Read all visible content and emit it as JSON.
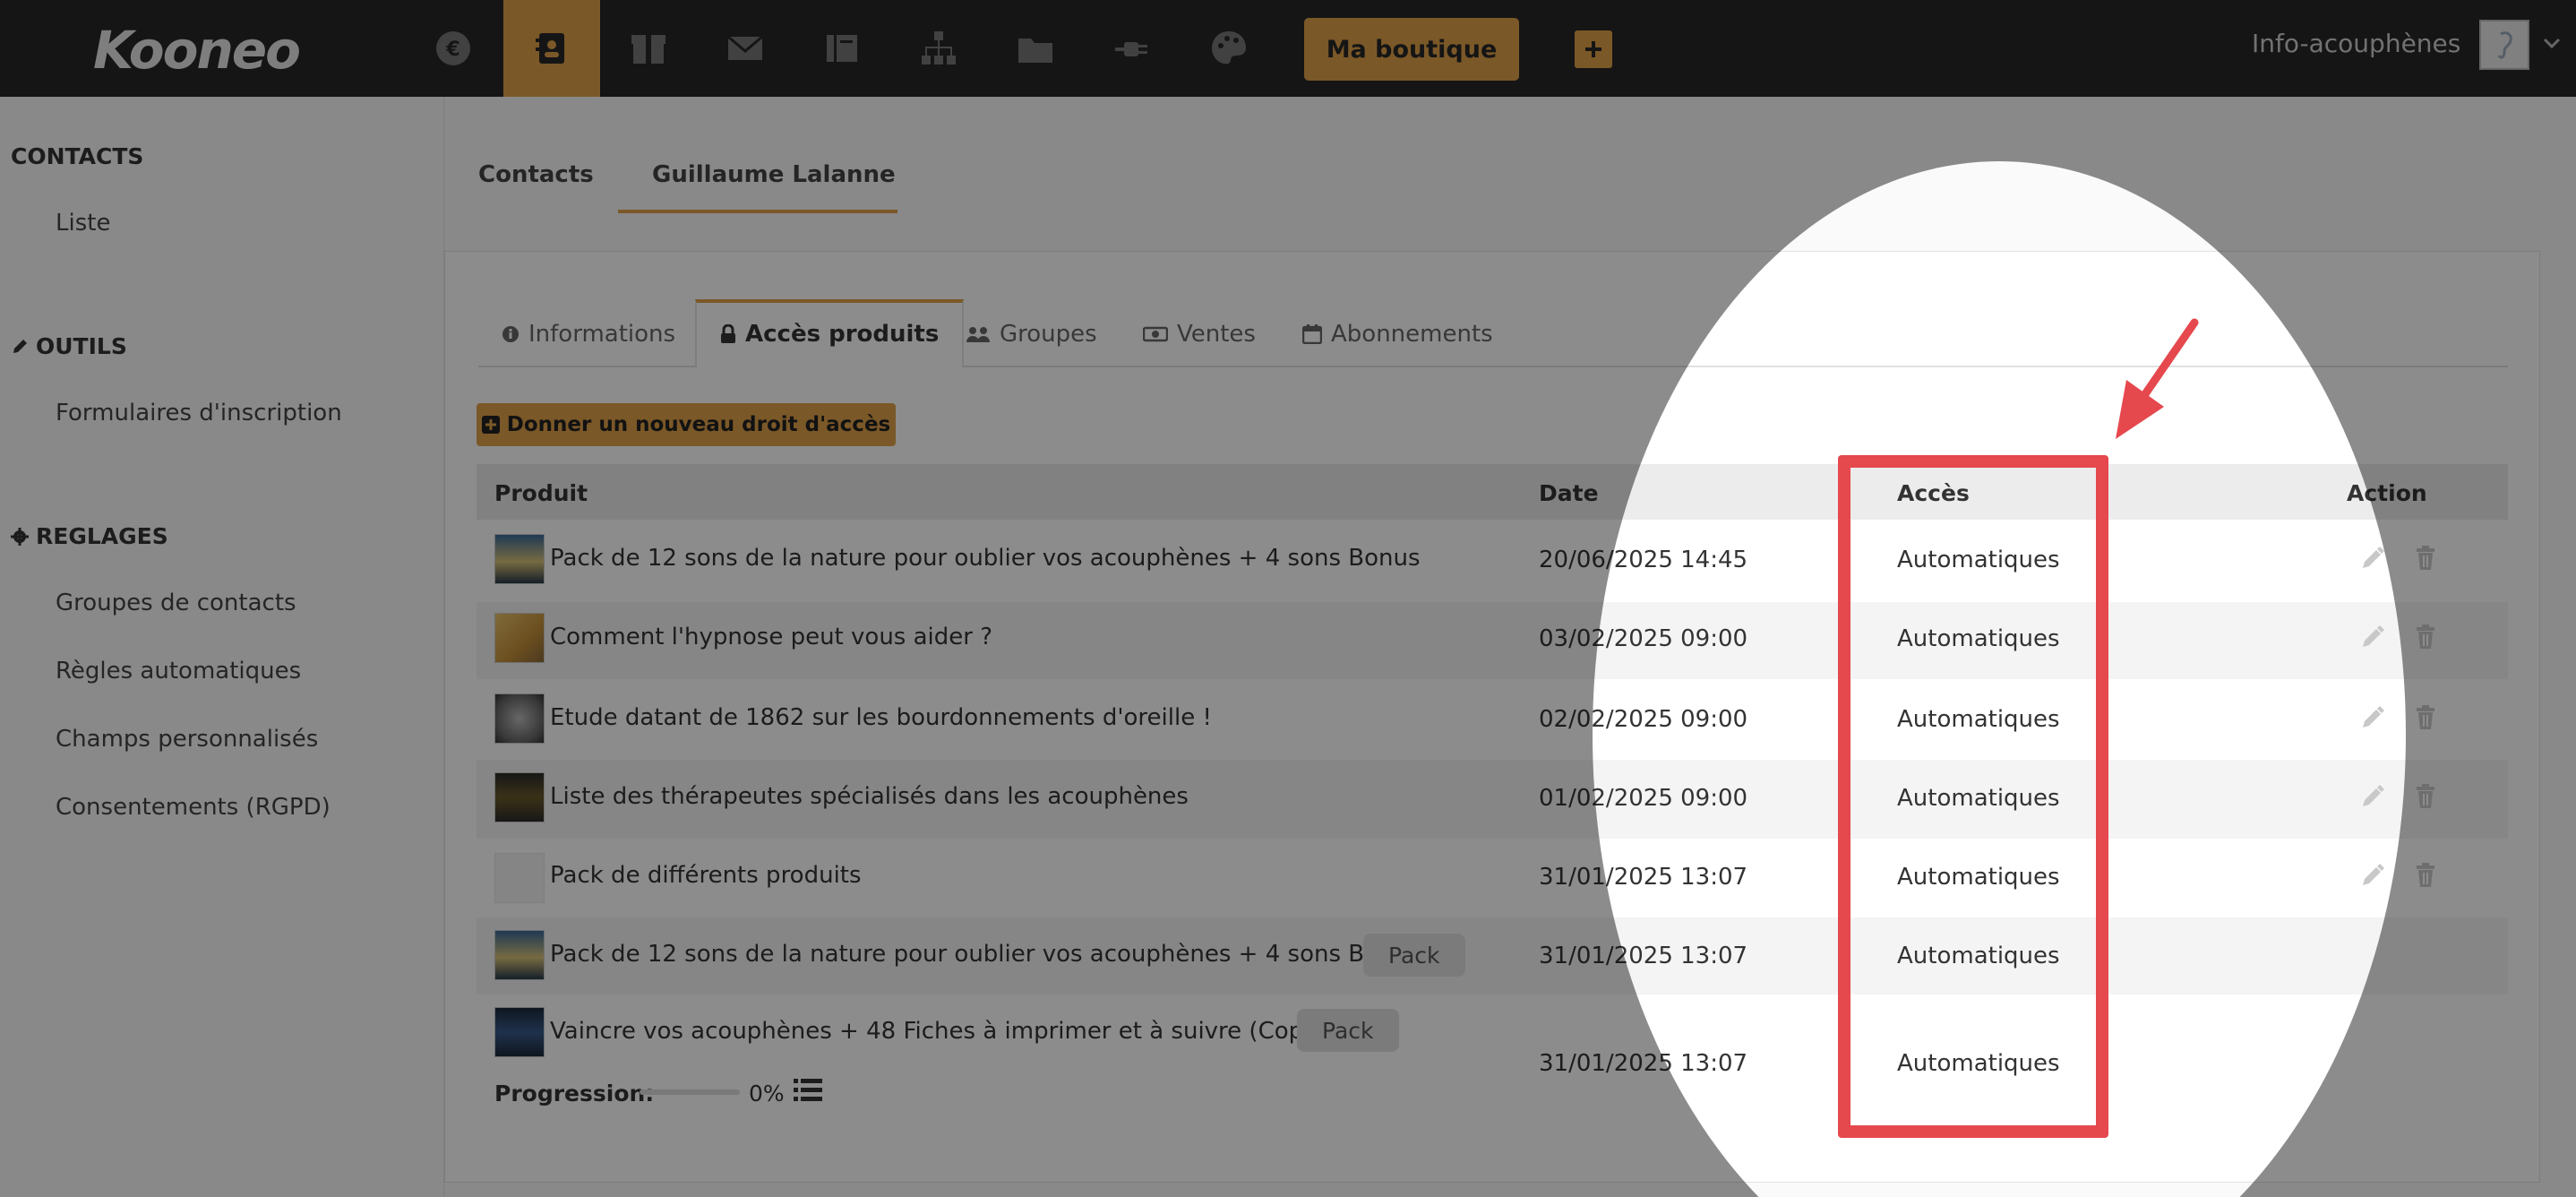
{
  "app": {
    "logo": "Kooneo",
    "shop_button": "Ma boutique",
    "account_name": "Info-acouphènes",
    "accent_color": "#e0a04a",
    "topbar_color": "#272727"
  },
  "topnav": [
    {
      "icon": "euro-icon"
    },
    {
      "icon": "contacts-icon",
      "active": true
    },
    {
      "icon": "box-icon"
    },
    {
      "icon": "mail-icon"
    },
    {
      "icon": "book-icon"
    },
    {
      "icon": "sitemap-icon"
    },
    {
      "icon": "folder-icon"
    },
    {
      "icon": "plug-icon"
    },
    {
      "icon": "palette-icon"
    }
  ],
  "sidebar": {
    "contacts_heading": "CONTACTS",
    "contacts_items": [
      "Liste"
    ],
    "outils_heading": "OUTILS",
    "outils_items": [
      "Formulaires d'inscription"
    ],
    "reglages_heading": "REGLAGES",
    "reglages_items": [
      "Groupes de contacts",
      "Règles automatiques",
      "Champs personnalisés",
      "Consentements (RGPD)"
    ]
  },
  "breadcrumb_tabs": {
    "contacts": "Contacts",
    "contact_name": "Guillaume Lalanne"
  },
  "inner_tabs": {
    "informations": "Informations",
    "acces_produits": "Accès produits",
    "groupes": "Groupes",
    "ventes": "Ventes",
    "abonnements": "Abonnements"
  },
  "grant_button": "Donner un nouveau droit d'accès",
  "table": {
    "headers": {
      "produit": "Produit",
      "date": "Date",
      "acces": "Accès",
      "action": "Action"
    },
    "rows": [
      {
        "product": "Pack de 12 sons de la nature pour oublier vos acouphènes + 4 sons Bonus",
        "date": "20/06/2025 14:45",
        "access": "Automatiques",
        "badge": "",
        "actions": true
      },
      {
        "product": "Comment l'hypnose peut vous aider ?",
        "date": "03/02/2025 09:00",
        "access": "Automatiques",
        "badge": "",
        "actions": true
      },
      {
        "product": "Etude datant de 1862 sur les bourdonnements d'oreille !",
        "date": "02/02/2025 09:00",
        "access": "Automatiques",
        "badge": "",
        "actions": true
      },
      {
        "product": "Liste des thérapeutes spécialisés dans les acouphènes",
        "date": "01/02/2025 09:00",
        "access": "Automatiques",
        "badge": "",
        "actions": true
      },
      {
        "product": "Pack de différents produits",
        "date": "31/01/2025 13:07",
        "access": "Automatiques",
        "badge": "",
        "actions": true
      },
      {
        "product": "Pack de 12 sons de la nature pour oublier vos acouphènes + 4 sons Bonus",
        "date": "31/01/2025 13:07",
        "access": "Automatiques",
        "badge": "Pack",
        "actions": false
      },
      {
        "product": "Vaincre vos acouphènes + 48 Fiches à imprimer et à suivre (Copie)",
        "date": "31/01/2025 13:07",
        "access": "Automatiques",
        "badge": "Pack",
        "actions": false
      }
    ],
    "progress_label": "Progression:",
    "progress_value": "0%",
    "progress_fraction": 0
  },
  "annotation": {
    "box_color": "#e5484d"
  }
}
